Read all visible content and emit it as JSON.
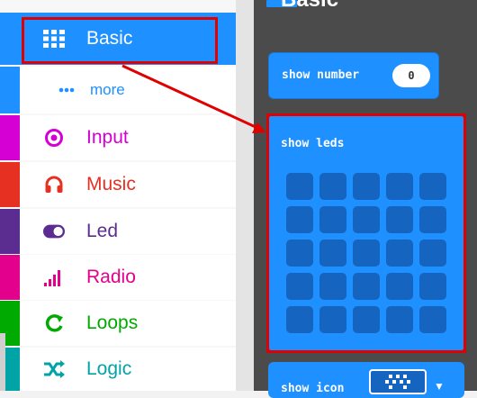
{
  "categories": [
    {
      "id": "basic",
      "label": "Basic",
      "icon": "grid-icon",
      "color": "#1e90ff"
    },
    {
      "id": "more",
      "label": "more",
      "icon": "more-dots-icon",
      "color": "#1e90ff"
    },
    {
      "id": "input",
      "label": "Input",
      "icon": "target-icon",
      "color": "#d400d4"
    },
    {
      "id": "music",
      "label": "Music",
      "icon": "headphones-icon",
      "color": "#e63022"
    },
    {
      "id": "led",
      "label": "Led",
      "icon": "toggle-icon",
      "color": "#5c2d91"
    },
    {
      "id": "radio",
      "label": "Radio",
      "icon": "signal-bars-icon",
      "color": "#e3008c"
    },
    {
      "id": "loops",
      "label": "Loops",
      "icon": "loop-arrow-icon",
      "color": "#00aa00"
    },
    {
      "id": "logic",
      "label": "Logic",
      "icon": "shuffle-icon",
      "color": "#00a4a6"
    }
  ],
  "flyout": {
    "title": "Basic",
    "blocks": {
      "show_number": {
        "label": "show number",
        "value": "0"
      },
      "show_leds": {
        "label": "show leds"
      },
      "show_icon": {
        "label": "show icon"
      }
    }
  },
  "colors": {
    "highlight": "#e00000",
    "flyout_bg": "#4b4b4b",
    "block": "#1e90ff",
    "led_off": "#1565c0"
  }
}
